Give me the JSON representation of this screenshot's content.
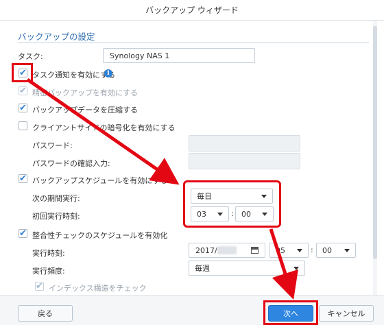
{
  "window": {
    "title": "バックアップ ウィザード"
  },
  "section": {
    "title": "バックアップの設定"
  },
  "task": {
    "label": "タスク:",
    "value": "Synology NAS 1"
  },
  "options": {
    "notify": "タスク通知を有効にする",
    "precise": "精密バックアップを有効にする",
    "compress": "バックアップデータを圧縮する",
    "encrypt": "クライアントサイドの暗号化を有効にする"
  },
  "password": {
    "label": "パスワード:",
    "confirm_label": "パスワードの確認入力:"
  },
  "schedule": {
    "enable_label": "バックアップスケジュールを有効にする",
    "next_label": "次の期間実行:",
    "next_value": "毎日",
    "first_time_label": "初回実行時刻:",
    "hour": "03",
    "minute": "00"
  },
  "integrity": {
    "enable_label": "整合性チェックのスケジュールを有効化",
    "run_time_label": "実行時刻:",
    "date_value": "2017/",
    "hour": "05",
    "minute": "00",
    "frequency_label": "実行頻度:",
    "frequency_value": "毎週",
    "index_check_label": "インデックス構造をチェック"
  },
  "footer": {
    "back": "戻る",
    "next": "次へ",
    "cancel": "キャンセル"
  },
  "colors": {
    "accent": "#2f80d1",
    "annotation": "#e30613"
  }
}
